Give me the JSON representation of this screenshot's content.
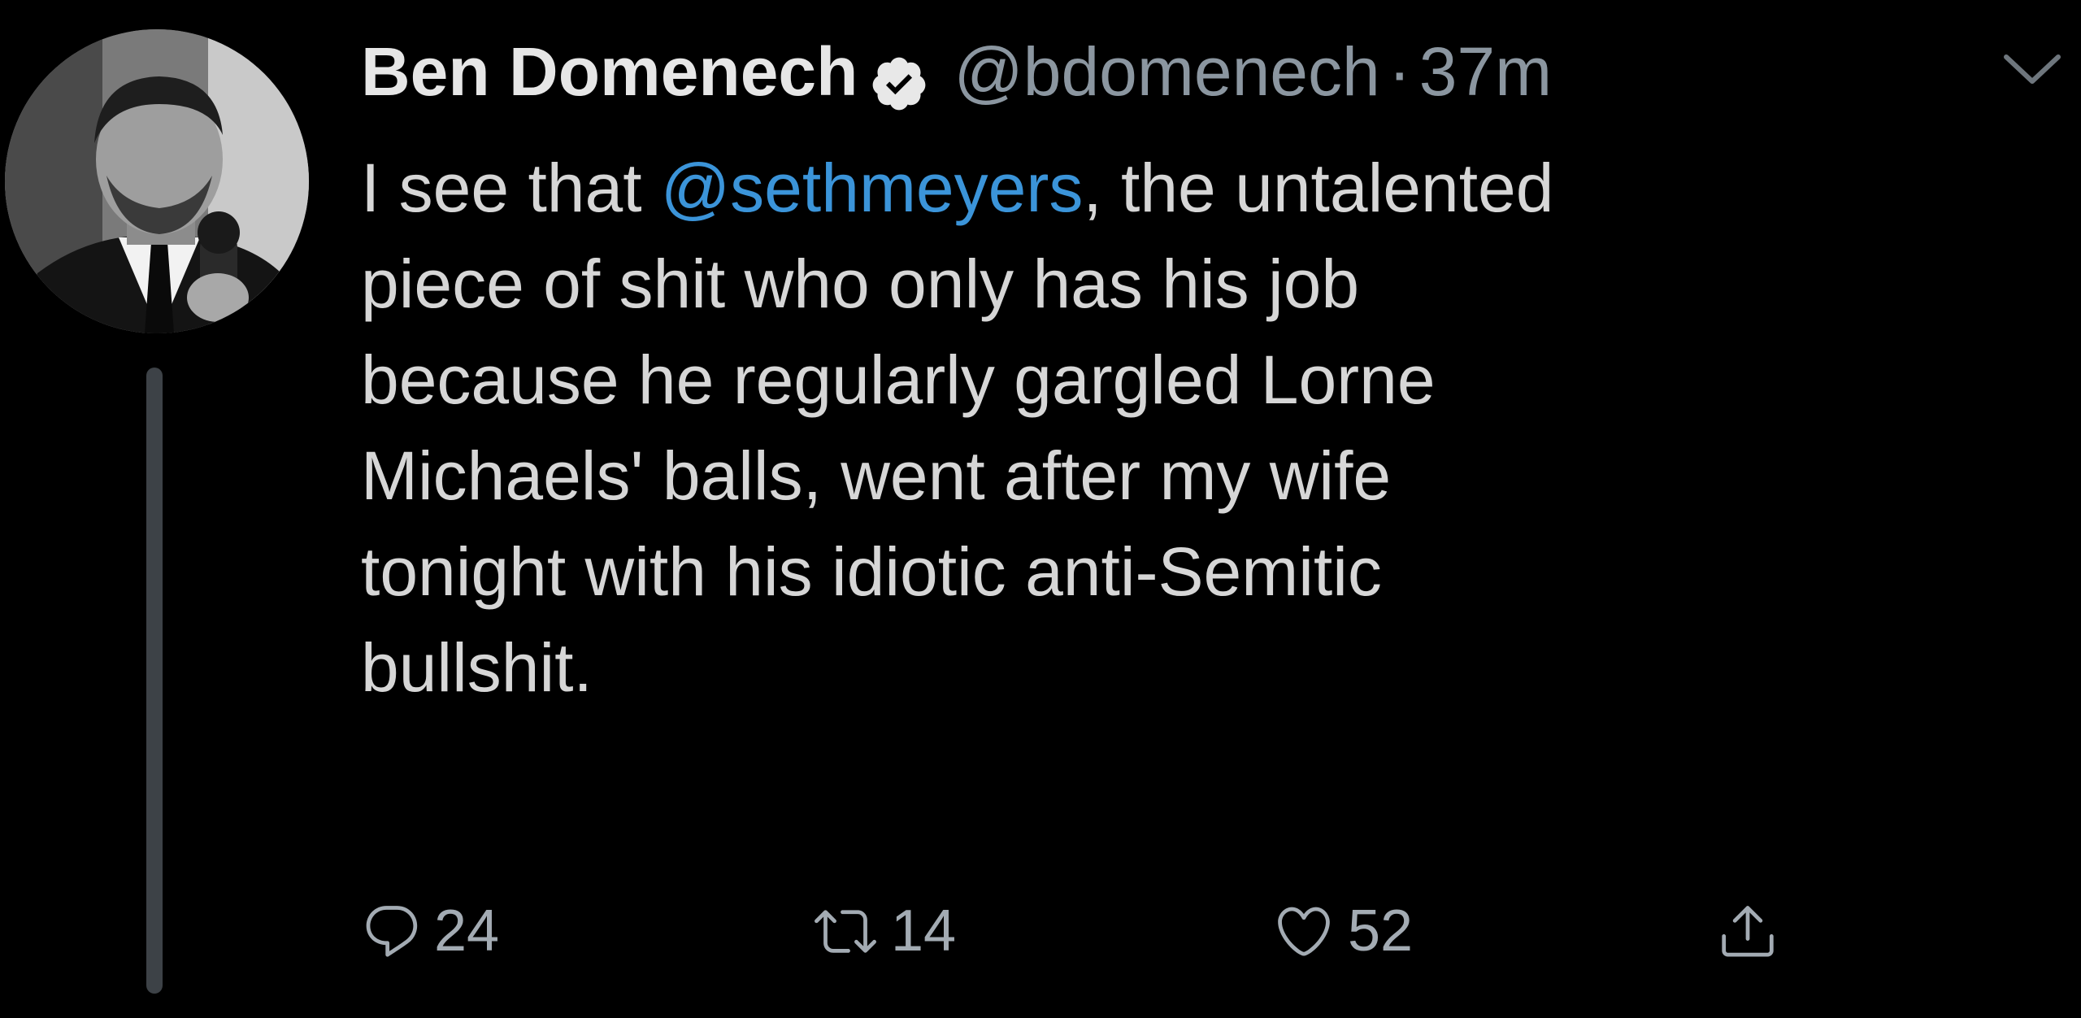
{
  "tweet": {
    "author_name": "Ben Domenech",
    "handle": "@bdomenech",
    "separator": "·",
    "time": "37m",
    "body": {
      "line1_before": "I see that ",
      "line1_mention": "@sethmeyers",
      "line1_after": ", the untalented",
      "line2": "piece of shit who only has his job",
      "line3": "because he regularly gargled Lorne",
      "line4": "Michaels' balls, went after my wife",
      "line5": "tonight with his idiotic anti-Semitic",
      "line6": "bullshit."
    },
    "actions": {
      "replies": "24",
      "retweets": "14",
      "likes": "52"
    }
  },
  "icons": {
    "verified": "verified-badge-icon",
    "menu": "chevron-down-icon",
    "reply": "reply-icon",
    "retweet": "retweet-icon",
    "like": "heart-icon",
    "share": "share-icon"
  },
  "colors": {
    "background": "#000000",
    "name": "#e6e6e6",
    "body_text": "#d6d6d6",
    "secondary_text": "#8b96a0",
    "mention": "#3b94d9",
    "thread_line": "#3d4247"
  }
}
